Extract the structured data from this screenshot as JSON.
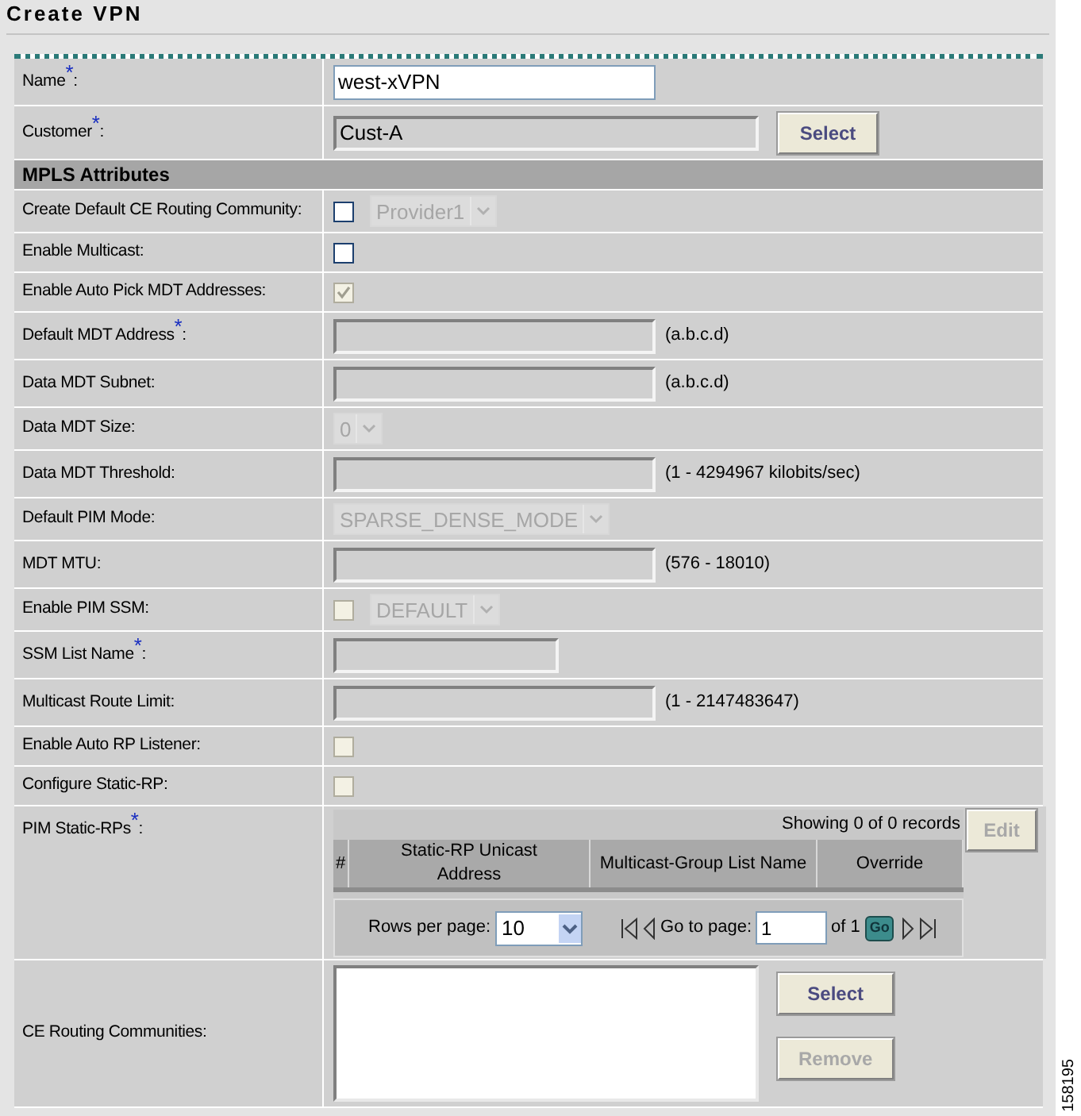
{
  "title": "Create VPN",
  "rows": [
    {
      "kind": "text",
      "label": "Name$^{*}$:",
      "value": "west-xVPN",
      "disabled": false
    },
    {
      "kind": "text_button",
      "label": "Customer$^{*}$:",
      "value": "Cust-A",
      "disabled": true,
      "button": {
        "label": "Select",
        "disabled": false
      }
    },
    {
      "kind": "section",
      "label": "MPLS Attributes"
    },
    {
      "kind": "checkbox_select",
      "label": "Create Default CE Routing Community:",
      "checked": false,
      "disabled": false,
      "select": {
        "value": "Provider1",
        "disabled": true
      }
    },
    {
      "kind": "checkbox",
      "label": "Enable Multicast:",
      "checked": false,
      "disabled": false
    },
    {
      "kind": "checkbox",
      "label": "Enable Auto Pick MDT Addresses:",
      "checked": true,
      "disabled": true
    },
    {
      "kind": "text",
      "label": "Default MDT Address$^{*}$:",
      "value": "",
      "disabled": true,
      "hint": "(a.b.c.d)"
    },
    {
      "kind": "text",
      "label": "Data MDT Subnet:",
      "value": "",
      "disabled": true,
      "hint": "(a.b.c.d)"
    },
    {
      "kind": "select",
      "label": "Data MDT Size:",
      "select": {
        "value": "0",
        "disabled": true
      }
    },
    {
      "kind": "text",
      "label": "Data MDT Threshold:",
      "value": "",
      "disabled": true,
      "hint": "(1 - 4294967 kilobits/sec)"
    },
    {
      "kind": "select",
      "label": "Default PIM Mode:",
      "select": {
        "value": "SPARSE_DENSE_MODE",
        "disabled": true
      }
    },
    {
      "kind": "text",
      "label": "MDT MTU:",
      "value": "",
      "disabled": true,
      "hint": "(576 - 18010)"
    },
    {
      "kind": "checkbox_select",
      "label": "Enable PIM SSM:",
      "checked": false,
      "disabled": true,
      "select": {
        "value": "DEFAULT",
        "disabled": true
      }
    },
    {
      "kind": "text_short",
      "label": "SSM List Name$^{*}$:",
      "value": "",
      "disabled": true
    },
    {
      "kind": "text",
      "label": "Multicast Route Limit:",
      "value": "",
      "disabled": true,
      "hint": "(1 - 2147483647)"
    },
    {
      "kind": "checkbox",
      "label": "Enable Auto RP Listener:",
      "checked": false,
      "disabled": true
    },
    {
      "kind": "checkbox",
      "label": "Configure Static-RP:",
      "checked": false,
      "disabled": true
    },
    {
      "kind": "table",
      "label": "PIM Static-RPs$^{*}$:",
      "showing": "Showing 0 of 0 records",
      "button": {
        "label": "Edit",
        "disabled": true
      },
      "columns": [
        "#",
        "Static-RP Unicast Address",
        "Multicast-Group List Name",
        "Override"
      ],
      "pager": {
        "rows_label": "Rows per page:",
        "rows_value": "10",
        "goto_label": "Go to page:",
        "page": "1",
        "of": "of 1",
        "go": "Go"
      }
    },
    {
      "kind": "listbox",
      "label": "CE Routing Communities:",
      "buttons": [
        {
          "label": "Select",
          "disabled": false
        },
        {
          "label": "Remove",
          "disabled": true
        }
      ]
    }
  ],
  "figure_number": "158195"
}
